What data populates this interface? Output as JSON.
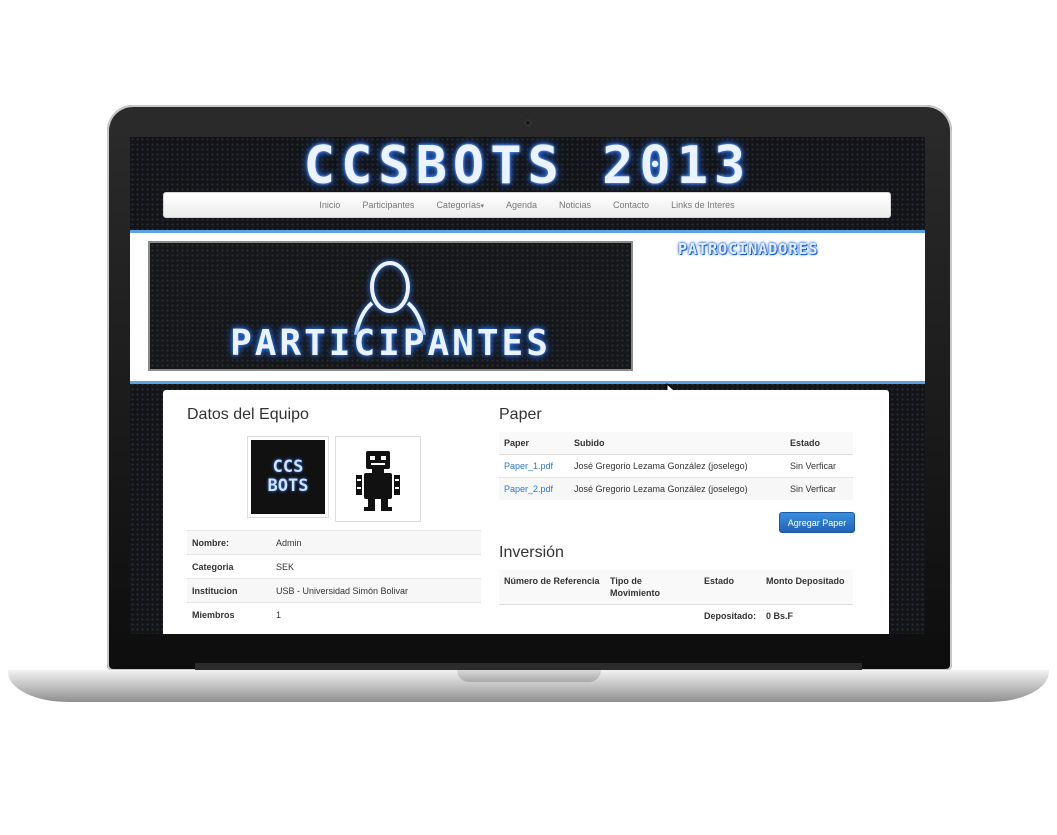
{
  "site": {
    "title": "CCSBOTS 2013",
    "nav": [
      "Inicio",
      "Participantes",
      "Categorías",
      "Agenda",
      "Noticias",
      "Contacto",
      "Links de Interes"
    ]
  },
  "banner": {
    "text": "PARTICIPANTES",
    "sponsors": "PATROCINADORES"
  },
  "team": {
    "heading": "Datos del Equipo",
    "logo_lines": [
      "CCS",
      "BOTS"
    ],
    "fields": [
      {
        "key": "Nombre:",
        "value": "Admin"
      },
      {
        "key": "Categoria",
        "value": "SEK"
      },
      {
        "key": "Institucion",
        "value": "USB - Universidad Simón Bolivar"
      },
      {
        "key": "Miembros",
        "value": "1"
      }
    ]
  },
  "paper": {
    "heading": "Paper",
    "columns": [
      "Paper",
      "Subido",
      "Estado"
    ],
    "rows": [
      {
        "file": "Paper_1.pdf",
        "uploader": "José Gregorio Lezama González (joselego)",
        "status": "Sin Verficar"
      },
      {
        "file": "Paper_2.pdf",
        "uploader": "José Gregorio Lezama González (joselego)",
        "status": "Sin Verficar"
      }
    ],
    "add_button": "Agregar Paper"
  },
  "investment": {
    "heading": "Inversión",
    "columns": [
      "Número de Referencia",
      "Tipo de Movimiento",
      "Estado",
      "Monto Depositado"
    ],
    "total_label": "Depositado:",
    "total_value": "0 Bs.F"
  }
}
